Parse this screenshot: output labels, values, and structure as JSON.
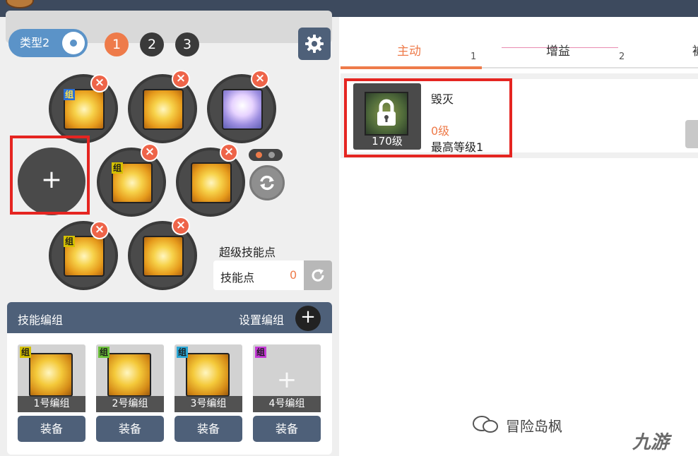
{
  "left": {
    "type_toggle_label": "类型2",
    "page_buttons": [
      "1",
      "2",
      "3"
    ],
    "active_page": "1",
    "skill_point_title": "超级技能点",
    "skill_point_label": "技能点",
    "skill_point_value": "0",
    "slot_group_tag": "组",
    "add_slot_symbol": "+",
    "remove_symbol": "×"
  },
  "groups": {
    "title": "技能编组",
    "set_label": "设置编组",
    "add_symbol": "+",
    "tag": "组",
    "cards": [
      {
        "caption": "1号编组",
        "equip": "装备",
        "tag_color": "#d4c000"
      },
      {
        "caption": "2号编组",
        "equip": "装备",
        "tag_color": "#6cc13a"
      },
      {
        "caption": "3号编组",
        "equip": "装备",
        "tag_color": "#2aa7d6"
      },
      {
        "caption": "4号编组",
        "equip": "装备",
        "tag_color": "#c43ad6",
        "empty_symbol": "+"
      }
    ]
  },
  "right": {
    "tabs": [
      {
        "label": "主动",
        "num": "1"
      },
      {
        "label": "增益",
        "num": "2"
      },
      {
        "label": "被"
      }
    ],
    "skill": {
      "name": "毁灭",
      "required_level": "170级",
      "current_level": "0级",
      "max_level": "最高等级1"
    }
  },
  "watermark": {
    "text": "冒险岛枫",
    "brand": "九游"
  },
  "colors": {
    "accent": "#ee7b4a",
    "header": "#4e6079",
    "toggle": "#5b93c8",
    "highlight_box": "#e52521"
  }
}
